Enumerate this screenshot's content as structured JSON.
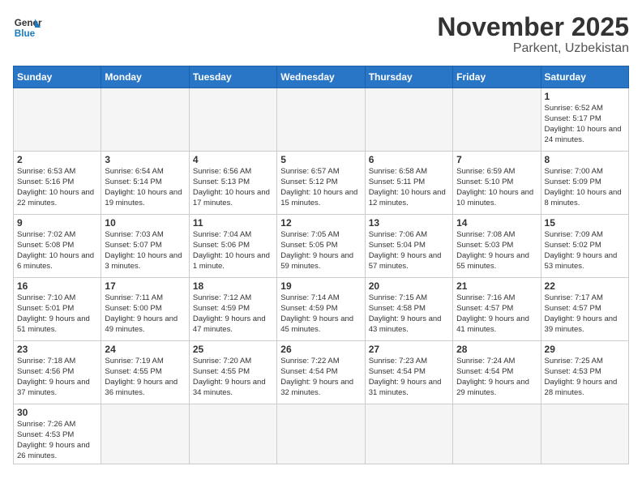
{
  "header": {
    "logo_general": "General",
    "logo_blue": "Blue",
    "month_title": "November 2025",
    "location": "Parkent, Uzbekistan"
  },
  "days_of_week": [
    "Sunday",
    "Monday",
    "Tuesday",
    "Wednesday",
    "Thursday",
    "Friday",
    "Saturday"
  ],
  "weeks": [
    [
      null,
      null,
      null,
      null,
      null,
      null,
      {
        "num": "1",
        "sunrise": "6:52 AM",
        "sunset": "5:17 PM",
        "daylight": "10 hours and 24 minutes."
      }
    ],
    [
      {
        "num": "2",
        "sunrise": "6:53 AM",
        "sunset": "5:16 PM",
        "daylight": "10 hours and 22 minutes."
      },
      {
        "num": "3",
        "sunrise": "6:54 AM",
        "sunset": "5:14 PM",
        "daylight": "10 hours and 19 minutes."
      },
      {
        "num": "4",
        "sunrise": "6:56 AM",
        "sunset": "5:13 PM",
        "daylight": "10 hours and 17 minutes."
      },
      {
        "num": "5",
        "sunrise": "6:57 AM",
        "sunset": "5:12 PM",
        "daylight": "10 hours and 15 minutes."
      },
      {
        "num": "6",
        "sunrise": "6:58 AM",
        "sunset": "5:11 PM",
        "daylight": "10 hours and 12 minutes."
      },
      {
        "num": "7",
        "sunrise": "6:59 AM",
        "sunset": "5:10 PM",
        "daylight": "10 hours and 10 minutes."
      },
      {
        "num": "8",
        "sunrise": "7:00 AM",
        "sunset": "5:09 PM",
        "daylight": "10 hours and 8 minutes."
      }
    ],
    [
      {
        "num": "9",
        "sunrise": "7:02 AM",
        "sunset": "5:08 PM",
        "daylight": "10 hours and 6 minutes."
      },
      {
        "num": "10",
        "sunrise": "7:03 AM",
        "sunset": "5:07 PM",
        "daylight": "10 hours and 3 minutes."
      },
      {
        "num": "11",
        "sunrise": "7:04 AM",
        "sunset": "5:06 PM",
        "daylight": "10 hours and 1 minute."
      },
      {
        "num": "12",
        "sunrise": "7:05 AM",
        "sunset": "5:05 PM",
        "daylight": "9 hours and 59 minutes."
      },
      {
        "num": "13",
        "sunrise": "7:06 AM",
        "sunset": "5:04 PM",
        "daylight": "9 hours and 57 minutes."
      },
      {
        "num": "14",
        "sunrise": "7:08 AM",
        "sunset": "5:03 PM",
        "daylight": "9 hours and 55 minutes."
      },
      {
        "num": "15",
        "sunrise": "7:09 AM",
        "sunset": "5:02 PM",
        "daylight": "9 hours and 53 minutes."
      }
    ],
    [
      {
        "num": "16",
        "sunrise": "7:10 AM",
        "sunset": "5:01 PM",
        "daylight": "9 hours and 51 minutes."
      },
      {
        "num": "17",
        "sunrise": "7:11 AM",
        "sunset": "5:00 PM",
        "daylight": "9 hours and 49 minutes."
      },
      {
        "num": "18",
        "sunrise": "7:12 AM",
        "sunset": "4:59 PM",
        "daylight": "9 hours and 47 minutes."
      },
      {
        "num": "19",
        "sunrise": "7:14 AM",
        "sunset": "4:59 PM",
        "daylight": "9 hours and 45 minutes."
      },
      {
        "num": "20",
        "sunrise": "7:15 AM",
        "sunset": "4:58 PM",
        "daylight": "9 hours and 43 minutes."
      },
      {
        "num": "21",
        "sunrise": "7:16 AM",
        "sunset": "4:57 PM",
        "daylight": "9 hours and 41 minutes."
      },
      {
        "num": "22",
        "sunrise": "7:17 AM",
        "sunset": "4:57 PM",
        "daylight": "9 hours and 39 minutes."
      }
    ],
    [
      {
        "num": "23",
        "sunrise": "7:18 AM",
        "sunset": "4:56 PM",
        "daylight": "9 hours and 37 minutes."
      },
      {
        "num": "24",
        "sunrise": "7:19 AM",
        "sunset": "4:55 PM",
        "daylight": "9 hours and 36 minutes."
      },
      {
        "num": "25",
        "sunrise": "7:20 AM",
        "sunset": "4:55 PM",
        "daylight": "9 hours and 34 minutes."
      },
      {
        "num": "26",
        "sunrise": "7:22 AM",
        "sunset": "4:54 PM",
        "daylight": "9 hours and 32 minutes."
      },
      {
        "num": "27",
        "sunrise": "7:23 AM",
        "sunset": "4:54 PM",
        "daylight": "9 hours and 31 minutes."
      },
      {
        "num": "28",
        "sunrise": "7:24 AM",
        "sunset": "4:54 PM",
        "daylight": "9 hours and 29 minutes."
      },
      {
        "num": "29",
        "sunrise": "7:25 AM",
        "sunset": "4:53 PM",
        "daylight": "9 hours and 28 minutes."
      }
    ],
    [
      {
        "num": "30",
        "sunrise": "7:26 AM",
        "sunset": "4:53 PM",
        "daylight": "9 hours and 26 minutes."
      },
      null,
      null,
      null,
      null,
      null,
      null
    ]
  ]
}
